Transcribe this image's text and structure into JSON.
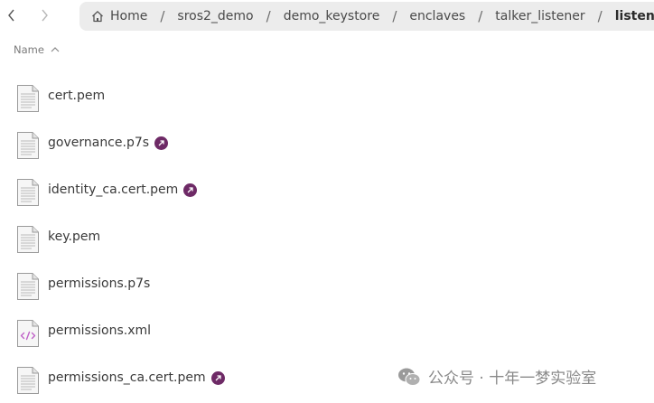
{
  "navigation": {
    "back_icon": "chevron-left-icon",
    "forward_icon": "chevron-right-icon"
  },
  "breadcrumb": {
    "home_icon": "home-icon",
    "items": [
      "Home",
      "sros2_demo",
      "demo_keystore",
      "enclaves",
      "talker_listener",
      "listener"
    ],
    "separator": "/"
  },
  "column_header": {
    "label": "Name",
    "sort_icon": "chevron-up-icon"
  },
  "files": [
    {
      "name": "cert.pem",
      "icon": "text-file-icon",
      "symlink": false
    },
    {
      "name": "governance.p7s",
      "icon": "text-file-icon",
      "symlink": true
    },
    {
      "name": "identity_ca.cert.pem",
      "icon": "text-file-icon",
      "symlink": true
    },
    {
      "name": "key.pem",
      "icon": "text-file-icon",
      "symlink": false
    },
    {
      "name": "permissions.p7s",
      "icon": "text-file-icon",
      "symlink": false
    },
    {
      "name": "permissions.xml",
      "icon": "xml-file-icon",
      "symlink": false
    },
    {
      "name": "permissions_ca.cert.pem",
      "icon": "text-file-icon",
      "symlink": true
    }
  ],
  "colors": {
    "symlink_badge": "#6e2a66",
    "pathbar_bg": "#ececec",
    "xml_icon_accent": "#c062c8"
  },
  "watermark": {
    "text": "公众号 · 十年一梦实验室"
  }
}
